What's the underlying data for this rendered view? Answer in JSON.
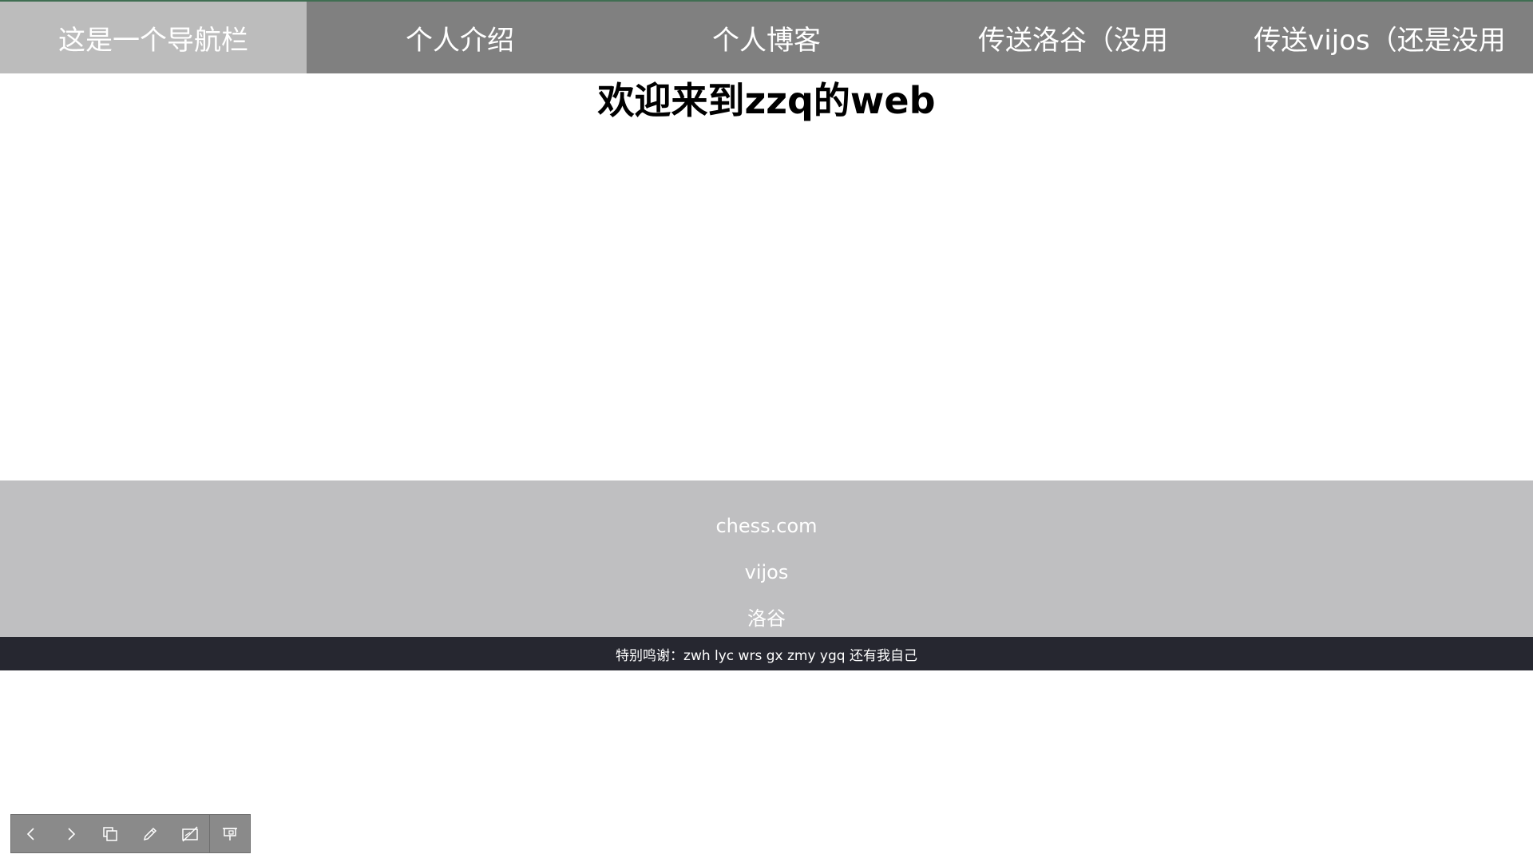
{
  "navbar": {
    "items": [
      {
        "label": "这是一个导航栏",
        "active": true
      },
      {
        "label": "个人介绍"
      },
      {
        "label": "个人博客"
      },
      {
        "label": "传送洛谷（没用"
      },
      {
        "label": "传送vijos（还是没用"
      }
    ]
  },
  "main": {
    "title": "欢迎来到zzq的web"
  },
  "footer": {
    "links": [
      "chess.com",
      "vijos",
      "洛谷"
    ],
    "thanks": "特别鸣谢：zwh lyc wrs gx zmy ygq 还有我自己"
  },
  "toolbar": {
    "icons": [
      "chevron-left-icon",
      "chevron-right-icon",
      "copy-icon",
      "pen-icon",
      "whiteboard-off-icon",
      "presentation-icon"
    ]
  },
  "colors": {
    "nav_bg": "#808080",
    "nav_active_bg": "#bcbcbc",
    "footer_bg": "#bfbfc1",
    "thanks_bg": "#262730",
    "toolbar_bg": "#8a8a8a"
  }
}
